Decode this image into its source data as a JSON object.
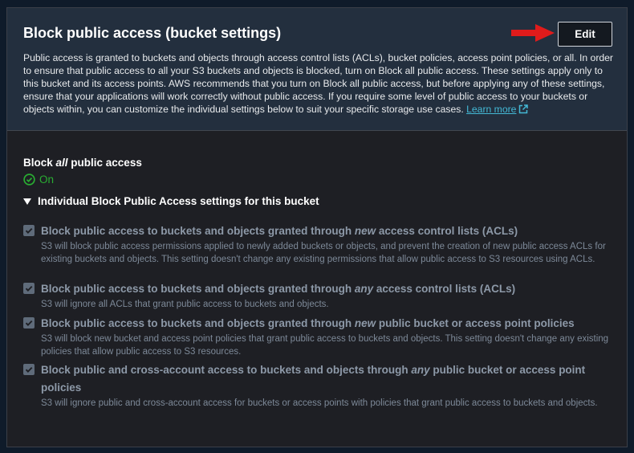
{
  "header": {
    "title": "Block public access (bucket settings)",
    "description": "Public access is granted to buckets and objects through access control lists (ACLs), bucket policies, access point policies, or all. In order to ensure that public access to all your S3 buckets and objects is blocked, turn on Block all public access. These settings apply only to this bucket and its access points. AWS recommends that you turn on Block all public access, but before applying any of these settings, ensure that your applications will work correctly without public access. If you require some level of public access to your buckets or objects within, you can customize the individual settings below to suit your specific storage use cases.",
    "learn_more": "Learn more",
    "edit_label": "Edit"
  },
  "block_all": {
    "label_prefix": "Block ",
    "label_emphasis": "all",
    "label_suffix": " public access",
    "status": "On"
  },
  "individual": {
    "heading": "Individual Block Public Access settings for this bucket",
    "settings": [
      {
        "title_pre": "Block public access to buckets and objects granted through ",
        "title_em": "new",
        "title_post": " access control lists (ACLs)",
        "desc": "S3 will block public access permissions applied to newly added buckets or objects, and prevent the creation of new public access ACLs for existing buckets and objects. This setting doesn't change any existing permissions that allow public access to S3 resources using ACLs.",
        "checked": true
      },
      {
        "title_pre": "Block public access to buckets and objects granted through ",
        "title_em": "any",
        "title_post": " access control lists (ACLs)",
        "desc": "S3 will ignore all ACLs that grant public access to buckets and objects.",
        "checked": true
      },
      {
        "title_pre": "Block public access to buckets and objects granted through ",
        "title_em": "new",
        "title_post": " public bucket or access point policies",
        "desc": "S3 will block new bucket and access point policies that grant public access to buckets and objects. This setting doesn't change any existing policies that allow public access to S3 resources.",
        "checked": true
      },
      {
        "title_pre": "Block public and cross-account access to buckets and objects through ",
        "title_em": "any",
        "title_post": " public bucket or access point policies",
        "desc": "S3 will ignore public and cross-account access for buckets or access points with policies that grant public access to buckets and objects.",
        "checked": true
      }
    ]
  },
  "colors": {
    "panel": "#1e1f24",
    "header": "#232f3e",
    "accent_link": "#44b9d6",
    "status_green": "#29ad32",
    "arrow_red": "#e01b1b"
  },
  "icons": {
    "arrow": "red-arrow-icon",
    "external": "external-link-icon",
    "status": "check-circle-icon",
    "expander": "caret-down-icon",
    "checkbox": "checkmark-icon"
  }
}
